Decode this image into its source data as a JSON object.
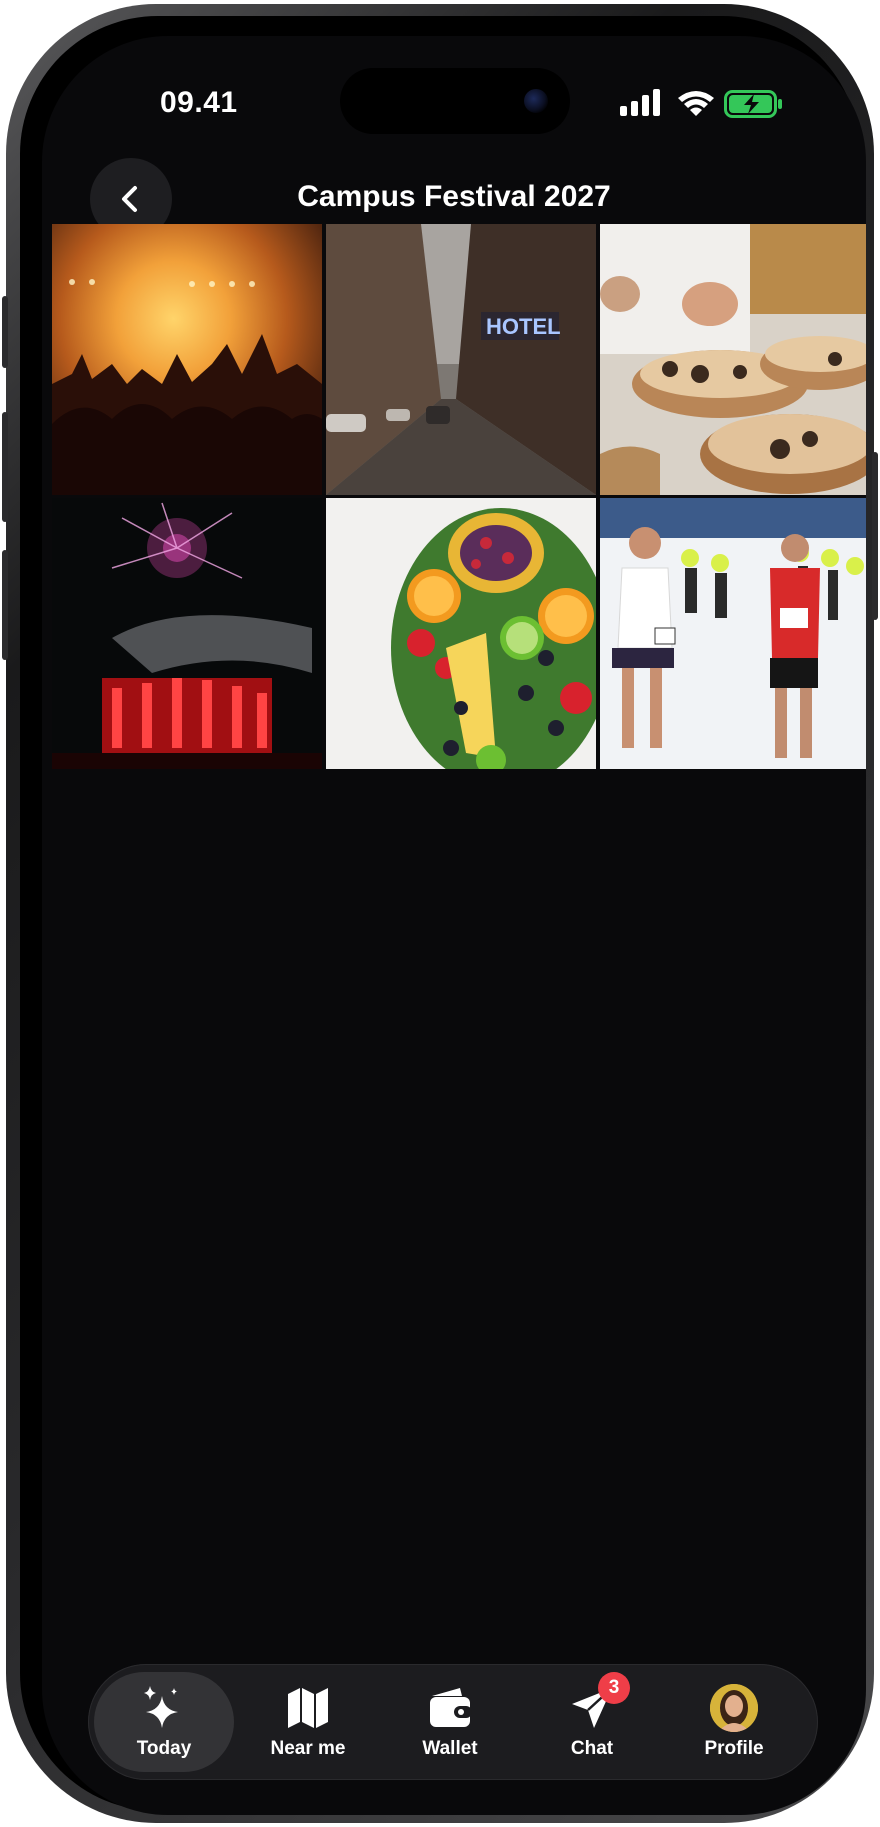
{
  "status": {
    "time": "09.41"
  },
  "header": {
    "title": "Campus Festival 2027"
  },
  "gallery": [
    {
      "name": "concert-crowd-photo"
    },
    {
      "name": "city-street-hotel-photo"
    },
    {
      "name": "chef-plating-food-photo"
    },
    {
      "name": "fireworks-stage-photo"
    },
    {
      "name": "fruit-platter-photo"
    },
    {
      "name": "marathon-runners-photo"
    }
  ],
  "tabs": {
    "today": "Today",
    "near_me": "Near me",
    "wallet": "Wallet",
    "chat": "Chat",
    "chat_badge": "3",
    "profile": "Profile"
  },
  "colors": {
    "background": "#09090b",
    "tabbar": "#1c1c1f",
    "badge": "#ef3e48",
    "battery": "#34c759"
  }
}
